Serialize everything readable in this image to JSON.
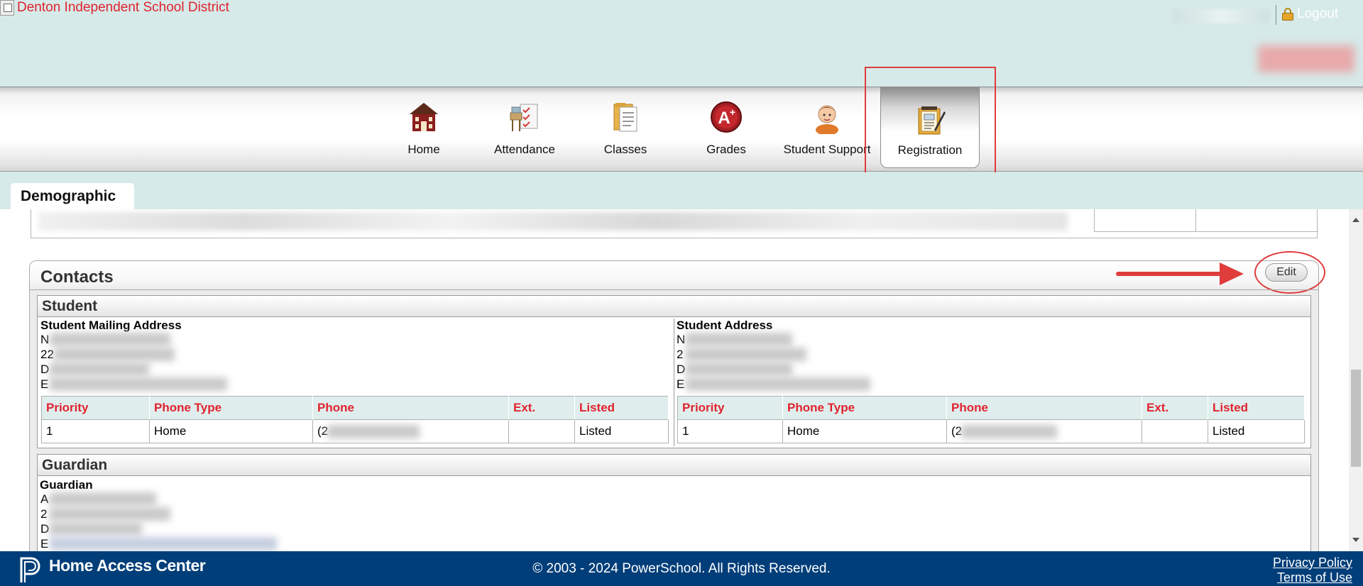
{
  "header": {
    "district_name": "Denton Independent School District",
    "logout_label": "Logout"
  },
  "nav": {
    "items": [
      {
        "label": "Home",
        "icon": "house-icon"
      },
      {
        "label": "Attendance",
        "icon": "checklist-icon"
      },
      {
        "label": "Classes",
        "icon": "folder-icon"
      },
      {
        "label": "Grades",
        "icon": "grade-a-plus-icon"
      },
      {
        "label": "Student Support",
        "icon": "student-icon"
      },
      {
        "label": "Registration",
        "icon": "registration-clipboard-icon"
      }
    ],
    "active": "Registration"
  },
  "tabs": {
    "active_label": "Demographic"
  },
  "contacts": {
    "title": "Contacts",
    "edit_label": "Edit",
    "student": {
      "title": "Student",
      "mailing": {
        "title": "Student Mailing Address",
        "line_initials": [
          "N",
          "22",
          "D",
          "E"
        ]
      },
      "address": {
        "title": "Student Address",
        "line_initials": [
          "N",
          "2",
          "D",
          "E"
        ]
      },
      "phone_headers": [
        "Priority",
        "Phone Type",
        "Phone",
        "Ext.",
        "Listed"
      ],
      "mailing_phone": {
        "priority": "1",
        "type": "Home",
        "phone": "(2",
        "ext": "",
        "listed": "Listed"
      },
      "address_phone": {
        "priority": "1",
        "type": "Home",
        "phone": "(2",
        "ext": "",
        "listed": "Listed"
      }
    },
    "guardian": {
      "title": "Guardian",
      "sub_title": "Guardian",
      "line_initials": [
        "A",
        "2",
        "D",
        "E"
      ]
    }
  },
  "footer": {
    "brand": "Home Access Center",
    "copyright": "© 2003 - 2024 PowerSchool. All Rights Reserved.",
    "privacy_label": "Privacy Policy",
    "terms_label": "Terms of Use"
  },
  "colors": {
    "accent_red": "#e0232e",
    "header_bg": "#d6eae9",
    "footer_bg": "#003e79",
    "annotation_red": "#e03c3c"
  }
}
